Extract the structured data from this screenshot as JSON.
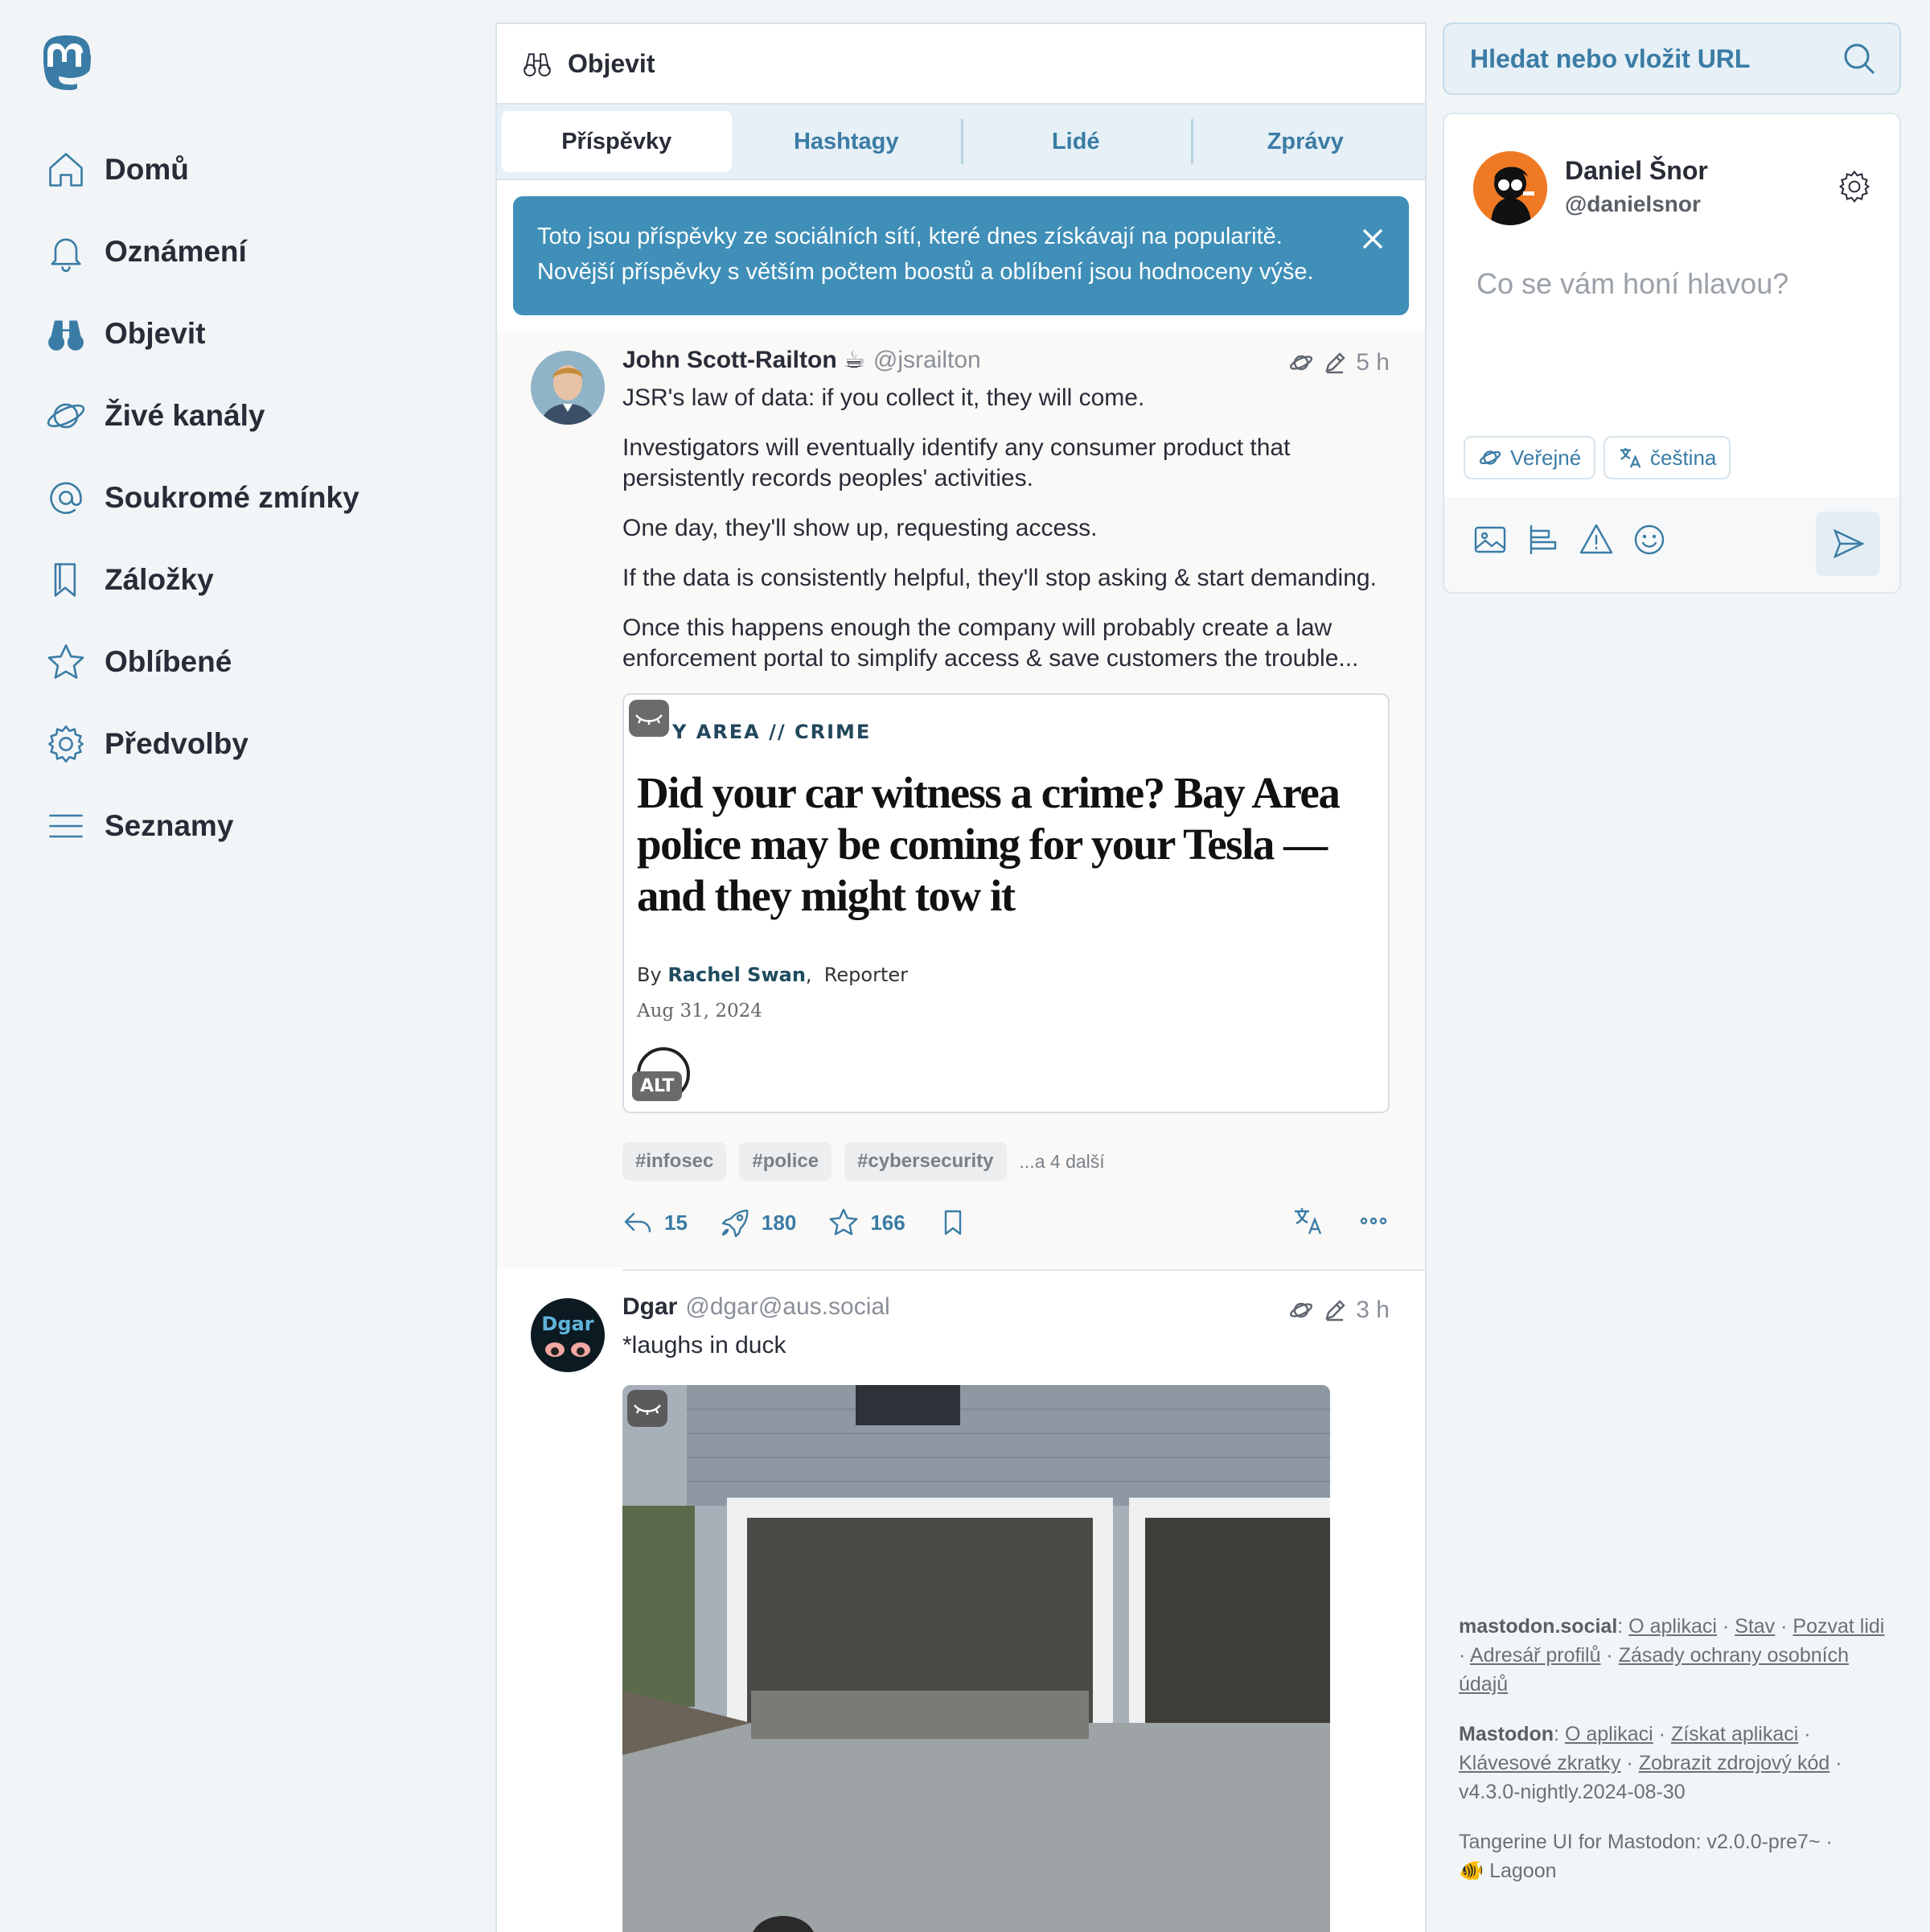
{
  "nav": {
    "items": [
      {
        "label": "Domů",
        "icon": "home-icon"
      },
      {
        "label": "Oznámení",
        "icon": "bell-icon"
      },
      {
        "label": "Objevit",
        "icon": "binoculars-icon"
      },
      {
        "label": "Živé kanály",
        "icon": "planet-icon"
      },
      {
        "label": "Soukromé zmínky",
        "icon": "at-icon"
      },
      {
        "label": "Záložky",
        "icon": "bookmark-icon"
      },
      {
        "label": "Oblíbené",
        "icon": "star-icon"
      },
      {
        "label": "Předvolby",
        "icon": "gear-icon"
      },
      {
        "label": "Seznamy",
        "icon": "list-icon"
      }
    ]
  },
  "column": {
    "title": "Objevit",
    "tabs": [
      "Příspěvky",
      "Hashtagy",
      "Lidé",
      "Zprávy"
    ],
    "active_tab": "Příspěvky",
    "banner": {
      "line1": "Toto jsou příspěvky ze sociálních sítí, které dnes získávají na popularitě.",
      "line2": "Novější příspěvky s větším počtem boostů a oblíbení jsou hodnoceny výše."
    }
  },
  "posts": [
    {
      "name": "John Scott-Railton ☕",
      "handle": "@jsrailton",
      "time": "5 h",
      "paragraphs": [
        "JSR's law of data: if you collect it, they will come.",
        "Investigators will eventually identify any consumer product that persistently records peoples' activities.",
        "One day, they'll show up, requesting access.",
        "If the data is consistently helpful, they'll stop asking & start demanding.",
        "Once this happens enough the company will probably create a law enforcement portal to simplify access & save customers the trouble..."
      ],
      "card": {
        "kicker": "Y AREA // CRIME",
        "headline": "Did your car witness a crime? Bay Area police may be coming for your Tesla — and they might tow it",
        "byline_prefix": "By",
        "author": "Rachel Swan",
        "role": "Reporter",
        "date": "Aug 31, 2024",
        "alt_badge": "ALT"
      },
      "tags": [
        "#infosec",
        "#police",
        "#cybersecurity"
      ],
      "more_tags": "...a 4 další",
      "replies": "15",
      "boosts": "180",
      "favourites": "166"
    },
    {
      "name": "Dgar",
      "handle": "@dgar@aus.social",
      "time": "3 h",
      "text": "*laughs in duck"
    }
  ],
  "search": {
    "placeholder": "Hledat nebo vložit URL"
  },
  "compose": {
    "display_name": "Daniel Šnor",
    "handle": "@danielsnor",
    "placeholder": "Co se vám honí hlavou?",
    "visibility": "Veřejné",
    "language": "čeština"
  },
  "footer": {
    "server": "mastodon.social",
    "server_links": [
      "O aplikaci",
      "Stav",
      "Pozvat lidi",
      "Adresář profilů",
      "Zásady ochrany osobních údajů"
    ],
    "mastodon": "Mastodon",
    "mastodon_links": [
      "O aplikaci",
      "Získat aplikaci",
      "Klávesové zkratky",
      "Zobrazit zdrojový kód"
    ],
    "version": "v4.3.0-nightly.2024-08-30",
    "theme": "Tangerine UI for Mastodon: v2.0.0-pre7~ ·",
    "theme_variant": "🐠 Lagoon"
  },
  "colors": {
    "accent": "#3a7ca5",
    "banner": "#3f8fb8",
    "background": "#f2f5f7"
  }
}
